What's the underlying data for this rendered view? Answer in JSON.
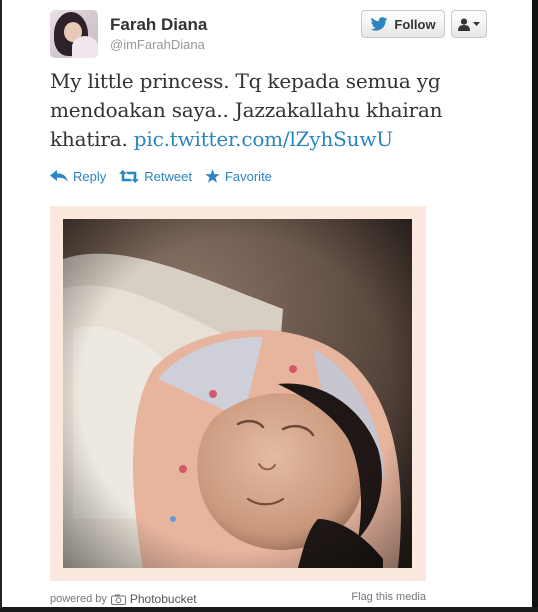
{
  "user": {
    "name": "Farah Diana",
    "handle": "@imFarahDiana"
  },
  "buttons": {
    "follow_label": "Follow"
  },
  "tweet": {
    "text": "My little princess. Tq kepada semua yg mendoakan saya.. Jazzakallahu khairan khatira.",
    "link": "pic.twitter.com/lZyhSuwU"
  },
  "actions": {
    "reply": "Reply",
    "retweet": "Retweet",
    "favorite": "Favorite"
  },
  "media": {
    "powered_by": "powered by",
    "provider": "Photobucket",
    "flag": "Flag this media"
  },
  "colors": {
    "link": "#2a85c0",
    "media_frame": "#fbe9df"
  },
  "icons": {
    "follow": "twitter-bird-icon",
    "user_menu": "user-silhouette-icon",
    "reply": "reply-arrow-icon",
    "retweet": "retweet-icon",
    "favorite": "star-icon",
    "provider": "camera-icon"
  }
}
